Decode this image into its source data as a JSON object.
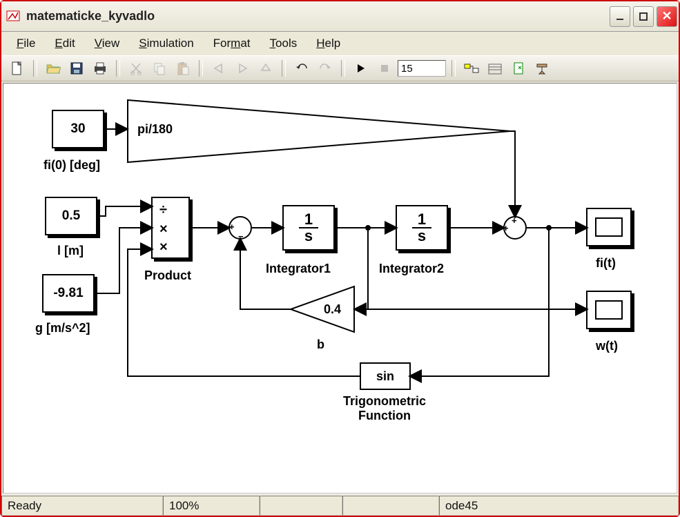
{
  "window": {
    "title": "matematicke_kyvadlo"
  },
  "menu": {
    "file": "File",
    "edit": "Edit",
    "view": "View",
    "simulation": "Simulation",
    "format": "Format",
    "tools": "Tools",
    "help": "Help"
  },
  "toolbar": {
    "simtime": "15"
  },
  "status": {
    "ready": "Ready",
    "zoom": "100%",
    "solver": "ode45"
  },
  "blocks": {
    "const_fi0": {
      "value": "30",
      "label": "fi(0) [deg]"
    },
    "const_l": {
      "value": "0.5",
      "label": "l [m]"
    },
    "const_g": {
      "value": "-9.81",
      "label": "g [m/s^2]"
    },
    "gain_deg2rad": {
      "value": "pi/180"
    },
    "product": {
      "label": "Product"
    },
    "sum1": {
      "signs": "+-"
    },
    "integrator1": {
      "num": "1",
      "den": "s",
      "label": "Integrator1"
    },
    "integrator2": {
      "num": "1",
      "den": "s",
      "label": "Integrator2"
    },
    "gain_b": {
      "value": "0.4",
      "label": "b"
    },
    "sum2": {
      "signs": "++"
    },
    "trig": {
      "fn": "sin",
      "label": "Trigonometric\nFunction",
      "label1": "Trigonometric",
      "label2": "Function"
    },
    "scope_fi": {
      "label": "fi(t)"
    },
    "scope_w": {
      "label": "w(t)"
    }
  }
}
